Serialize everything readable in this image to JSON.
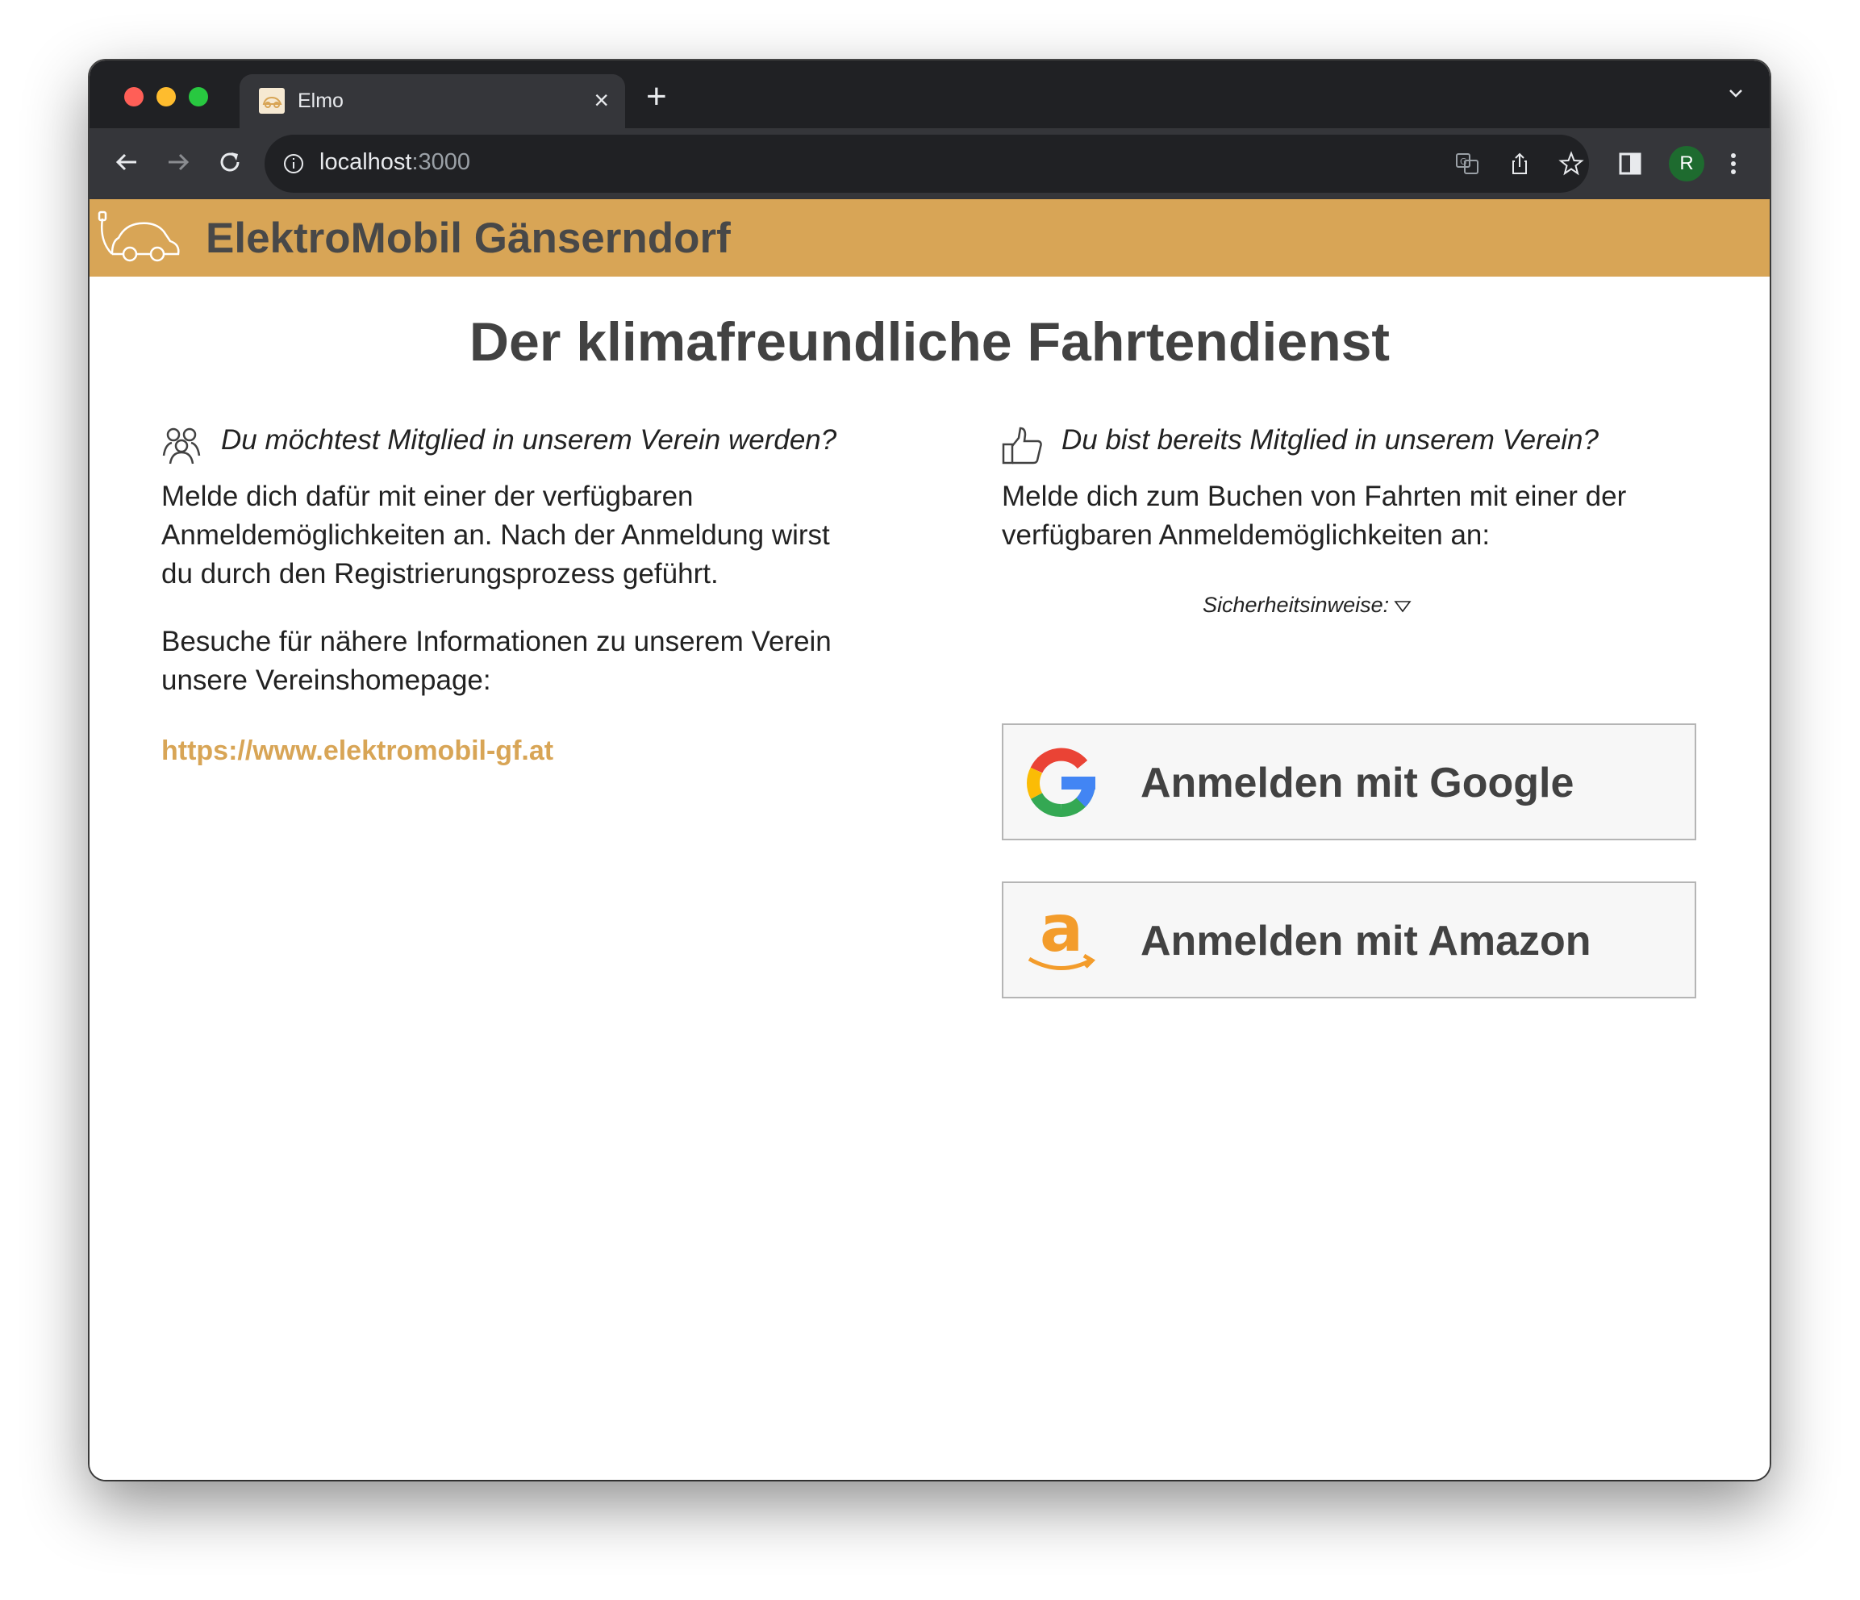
{
  "browser": {
    "tab_title": "Elmo",
    "url_host": "localhost",
    "url_port": ":3000",
    "avatar_letter": "R"
  },
  "app": {
    "title": "ElektroMobil Gänserndorf",
    "brand_color": "#d8a556"
  },
  "main": {
    "headline": "Der klimafreundliche Fahrtendienst",
    "left": {
      "heading": "Du möchtest Mitglied in unserem Verein werden?",
      "paragraph1": "Melde dich dafür mit einer der verfügbaren Anmeldemöglichkeiten an. Nach der Anmeldung wirst du durch den Registrierungsprozess geführt.",
      "paragraph2": "Besuche für nähere Informationen zu unserem Verein unsere Vereinshomepage:",
      "link": "https://www.elektromobil-gf.at"
    },
    "right": {
      "heading": "Du bist bereits Mitglied in unserem Verein?",
      "paragraph": "Melde dich zum Buchen von Fahrten mit einer der verfügbaren Anmeldemöglichkeiten an:",
      "security_label": "Sicherheitsinweise:",
      "google_label": "Anmelden mit Google",
      "amazon_label": "Anmelden mit Amazon"
    }
  },
  "icons": {
    "group": "people-group-icon",
    "thumbs_up": "thumbs-up-icon",
    "google": "google-logo-icon",
    "amazon": "amazon-logo-icon",
    "car_plug": "electric-car-logo-icon"
  }
}
